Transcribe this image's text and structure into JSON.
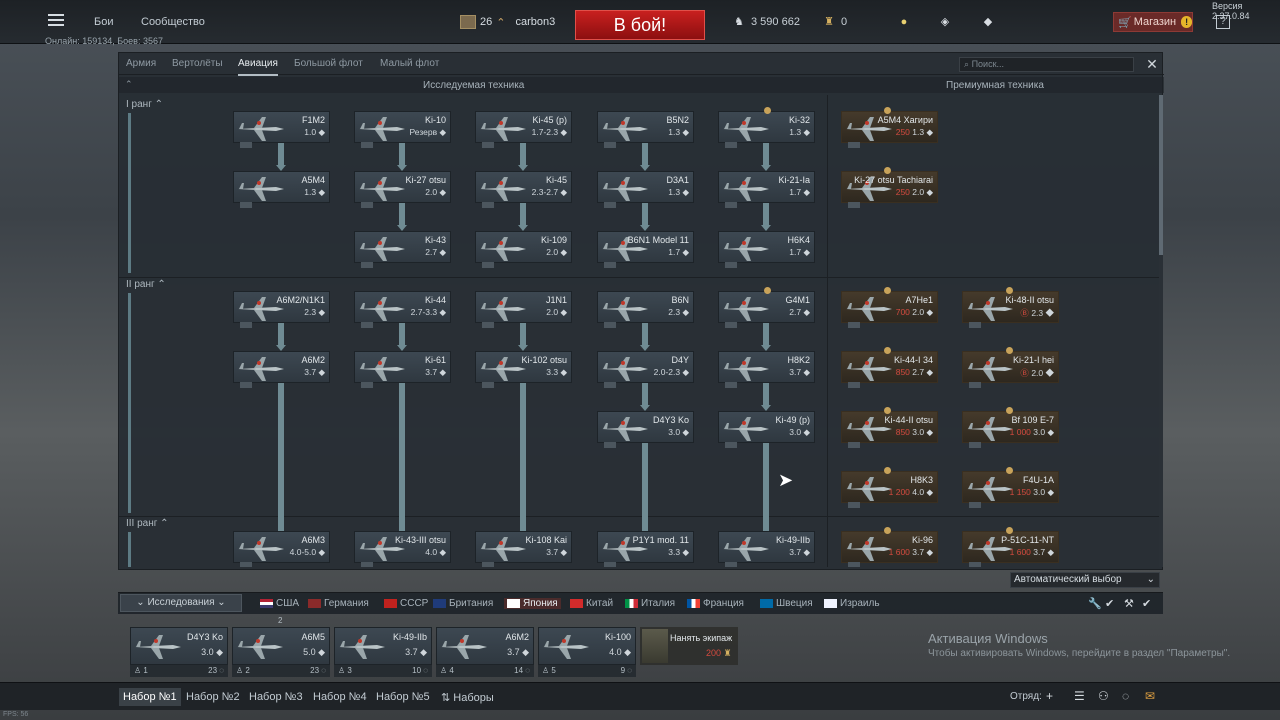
{
  "version": "Версия 2.37.0.84",
  "top": {
    "nav": [
      "Бои",
      "Сообщество"
    ],
    "online": "Онлайн: 159134, Боев: 3567",
    "player_level": "26",
    "player_name": "carbon3",
    "battle_button": "В бой!",
    "silver_lions": "3 590 662",
    "eagles": "0",
    "shop": "Магазин",
    "help": "?"
  },
  "tabs": [
    "Армия",
    "Вертолёты",
    "Авиация",
    "Большой флот",
    "Малый флот"
  ],
  "active_tab": "Авиация",
  "search_placeholder": "Поиск...",
  "close": "✕",
  "headers": {
    "research": "Исследуемая техника",
    "premium": "Премиумная техника"
  },
  "ranks": [
    "I ранг",
    "II ранг",
    "III ранг"
  ],
  "tree": {
    "rank1": [
      {
        "name": "F1M2",
        "br": "1.0"
      },
      {
        "name": "Ki-10",
        "br": "Резерв"
      },
      {
        "name": "Ki-45 (p)",
        "br": "1.7-2.3"
      },
      {
        "name": "B5N2",
        "br": "1.3"
      },
      {
        "name": "Ki-32",
        "br": "1.3"
      },
      {
        "name": "A5M4",
        "br": "1.3"
      },
      {
        "name": "Ki-27 otsu",
        "br": "2.0"
      },
      {
        "name": "Ki-45",
        "br": "2.3-2.7"
      },
      {
        "name": "D3A1",
        "br": "1.3"
      },
      {
        "name": "Ki-21-Ia",
        "br": "1.7"
      },
      {
        "name": "Ki-43",
        "br": "2.7"
      },
      {
        "name": "Ki-109",
        "br": "2.0"
      },
      {
        "name": "B6N1 Model 11",
        "br": "1.7"
      },
      {
        "name": "H6K4",
        "br": "1.7"
      }
    ],
    "rank1_premium": [
      {
        "name": "A5M4 Хагири",
        "price": "250",
        "br": "1.3"
      },
      {
        "name": "Ki-27 otsu Tachiarai",
        "price": "250",
        "br": "2.0"
      }
    ],
    "rank2": [
      {
        "name": "A6M2/N1K1",
        "br": "2.3"
      },
      {
        "name": "Ki-44",
        "br": "2.7-3.3"
      },
      {
        "name": "J1N1",
        "br": "2.0"
      },
      {
        "name": "B6N",
        "br": "2.3"
      },
      {
        "name": "G4M1",
        "br": "2.7"
      },
      {
        "name": "A6M2",
        "br": "3.7"
      },
      {
        "name": "Ki-61",
        "br": "3.7"
      },
      {
        "name": "Ki-102 otsu",
        "br": "3.3"
      },
      {
        "name": "D4Y",
        "br": "2.0-2.3"
      },
      {
        "name": "H8K2",
        "br": "3.7"
      },
      {
        "name": "D4Y3 Ko",
        "br": "3.0"
      },
      {
        "name": "Ki-49 (p)",
        "br": "3.0"
      }
    ],
    "rank2_premium": [
      {
        "name": "A7He1",
        "price": "700",
        "br": "2.0"
      },
      {
        "name": "Ki-48-II otsu",
        "price": "Ⓑ",
        "br": "2.3"
      },
      {
        "name": "Ki-44-I 34",
        "price": "850",
        "br": "2.7"
      },
      {
        "name": "Ki-21-I hei",
        "price": "Ⓑ",
        "br": "2.0"
      },
      {
        "name": "Ki-44-II otsu",
        "price": "850",
        "br": "3.0"
      },
      {
        "name": "Bf 109 E-7",
        "price": "1 000",
        "br": "3.0"
      },
      {
        "name": "H8K3",
        "price": "1 200",
        "br": "4.0"
      },
      {
        "name": "F4U-1A",
        "price": "1 150",
        "br": "3.0"
      }
    ],
    "rank3": [
      {
        "name": "A6M3",
        "br": "4.0-5.0"
      },
      {
        "name": "Ki-43-III otsu",
        "br": "4.0"
      },
      {
        "name": "Ki-108 Kai",
        "br": "3.7"
      },
      {
        "name": "P1Y1 mod. 11",
        "br": "3.3"
      },
      {
        "name": "Ki-49-IIb",
        "br": "3.7"
      }
    ],
    "rank3_premium": [
      {
        "name": "Ki-96",
        "price": "1 600",
        "br": "3.7"
      },
      {
        "name": "P-51C-11-NT",
        "price": "1 600",
        "br": "3.7"
      }
    ]
  },
  "auto_select": "Автоматический выбор",
  "research_button": "Исследования",
  "nations": [
    "США",
    "Германия",
    "СССР",
    "Британия",
    "Япония",
    "Китай",
    "Италия",
    "Франция",
    "Швеция",
    "Израиль"
  ],
  "active_nation": "Япония",
  "crew": [
    {
      "name": "D4Y3 Ko",
      "br": "3.0",
      "slot": "1",
      "crew": "23",
      "top": ""
    },
    {
      "name": "A6M5",
      "br": "5.0",
      "slot": "2",
      "crew": "23",
      "top": "2"
    },
    {
      "name": "Ki-49-IIb",
      "br": "3.7",
      "slot": "3",
      "crew": "10",
      "top": ""
    },
    {
      "name": "A6M2",
      "br": "3.7",
      "slot": "4",
      "crew": "14",
      "top": ""
    },
    {
      "name": "Ki-100",
      "br": "4.0",
      "slot": "5",
      "crew": "9",
      "top": ""
    }
  ],
  "hire_crew": {
    "label": "Нанять экипаж",
    "price": "200"
  },
  "windows": {
    "title": "Активация Windows",
    "text": "Чтобы активировать Windows, перейдите в раздел \"Параметры\"."
  },
  "presets": [
    "Набор №1",
    "Набор №2",
    "Набор №3",
    "Набор №4",
    "Набор №5",
    "Наборы"
  ],
  "squad": "Отряд:",
  "fps": "FPS: 56"
}
